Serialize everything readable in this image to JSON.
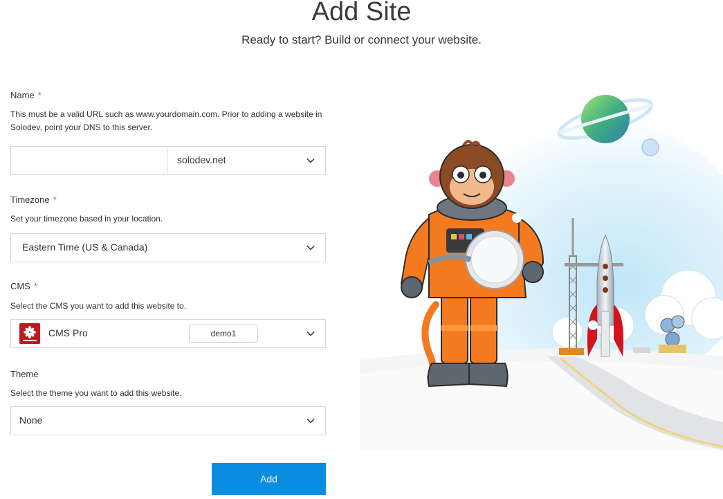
{
  "header": {
    "title": "Add Site",
    "subtitle": "Ready to start? Build or connect your website."
  },
  "form": {
    "name": {
      "label": "Name",
      "required_mark": "*",
      "help": "This must be a valid URL such as www.yourdomain.com. Prior to adding a website in Solodev, point your DNS to this server.",
      "value": "",
      "domain": "solodev.net"
    },
    "timezone": {
      "label": "Timezone",
      "required_mark": "*",
      "help": "Set your timezone based in your location.",
      "value": "Eastern Time (US & Canada)"
    },
    "cms": {
      "label": "CMS",
      "required_mark": "*",
      "help": "Select the CMS you want to add this website to.",
      "value": "CMS Pro",
      "badge": "demo1",
      "logo_icon": "solodev-logo"
    },
    "theme": {
      "label": "Theme",
      "help": "Select the theme you want to add this website.",
      "value": "None"
    },
    "submit_label": "Add"
  },
  "colors": {
    "accent": "#0a8de0",
    "required": "#d9534f",
    "brand_red": "#c4161c",
    "suit_orange": "#f47a20"
  },
  "illustration": {
    "icon": "astronaut-monkey-launchpad-illustration"
  }
}
